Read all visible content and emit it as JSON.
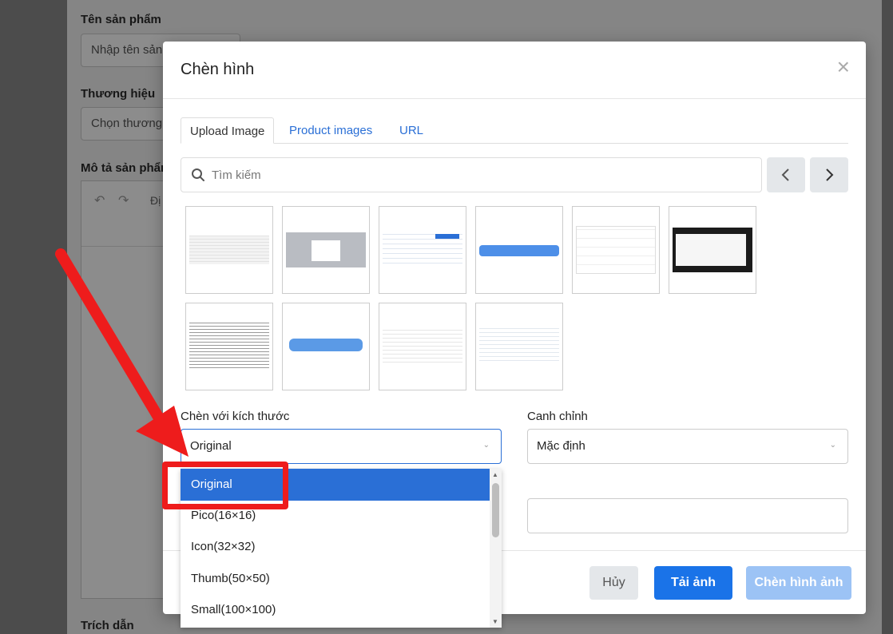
{
  "background": {
    "product_name_label": "Tên sản phẩm",
    "product_name_placeholder": "Nhập tên sản",
    "brand_label": "Thương hiệu",
    "brand_placeholder": "Chọn thương",
    "description_label": "Mô tả sản phẩm",
    "editor_toolbar_text": "Đị",
    "excerpt_label": "Trích dẫn"
  },
  "modal": {
    "title": "Chèn hình",
    "close": "×",
    "tabs": [
      "Upload Image",
      "Product images",
      "URL"
    ],
    "search_placeholder": "Tìm kiếm",
    "size_label": "Chèn với kích thước",
    "size_selected": "Original",
    "align_label": "Canh chỉnh",
    "align_selected": "Mặc định",
    "size_options": [
      "Original",
      "Pico(16×16)",
      "Icon(32×32)",
      "Thumb(50×50)",
      "Small(100×100)"
    ],
    "buttons": {
      "cancel": "Hủy",
      "upload": "Tải ảnh",
      "insert": "Chèn hình ảnh"
    }
  },
  "colors": {
    "primary": "#1a73e8",
    "selected_option": "#2a6fd6",
    "insert_disabled": "#9cc3f5",
    "annotation": "#ee1c1c"
  }
}
